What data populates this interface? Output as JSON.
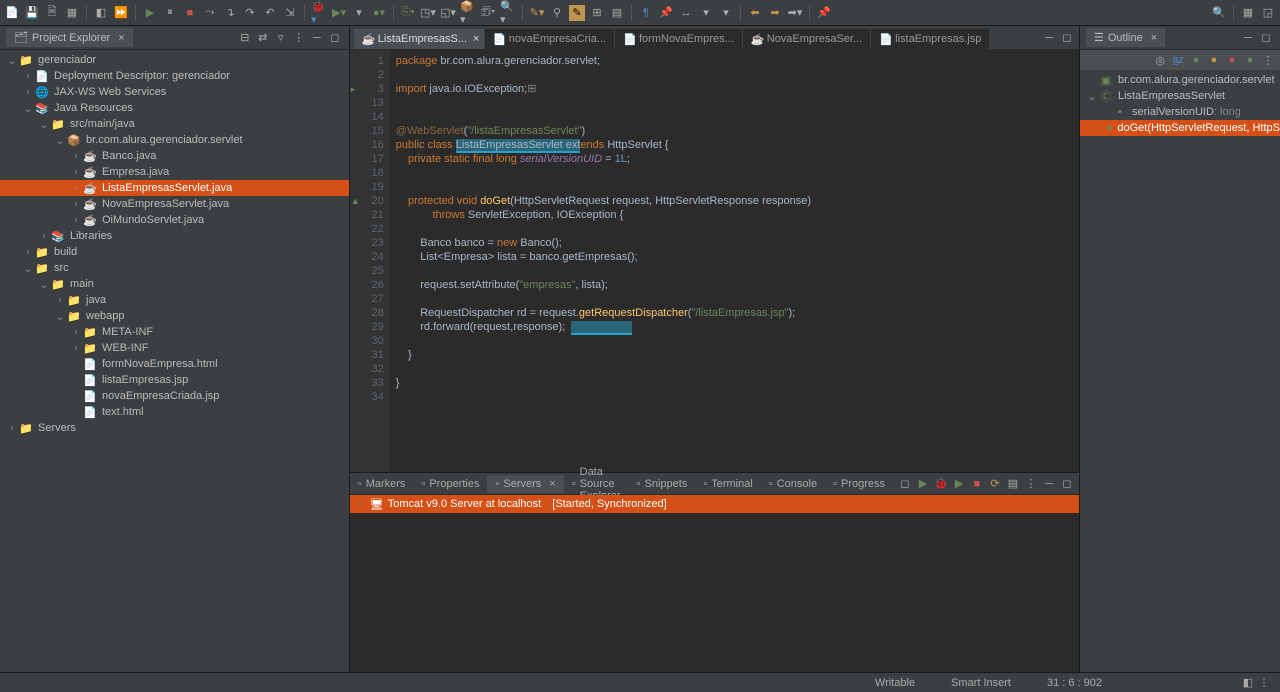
{
  "toolbar": {
    "icons": [
      "new",
      "save",
      "save-all",
      "print",
      "build",
      "sep",
      "run",
      "pause",
      "stop",
      "restart",
      "step-over",
      "step-into",
      "step-out",
      "step-return",
      "resume",
      "sep",
      "debug",
      "coverage",
      "run-last",
      "profile",
      "run-config",
      "sep",
      "new-server",
      "external",
      "ant",
      "search",
      "annotation",
      "task",
      "sep",
      "edit",
      "pencil",
      "highlight",
      "sep",
      "nav-back",
      "nav-fwd",
      "nav-last",
      "sep",
      "pin",
      "link",
      "sync",
      "sep",
      "perspective",
      "sep",
      "back",
      "forward",
      "recent",
      "drop"
    ]
  },
  "projectExplorer": {
    "title": "Project Explorer",
    "tree": [
      {
        "d": 0,
        "exp": true,
        "icon": "project",
        "label": "gerenciador"
      },
      {
        "d": 1,
        "exp": false,
        "icon": "deploy",
        "label": "Deployment Descriptor: gerenciador"
      },
      {
        "d": 1,
        "exp": false,
        "icon": "jax",
        "label": "JAX-WS Web Services"
      },
      {
        "d": 1,
        "exp": true,
        "icon": "javares",
        "label": "Java Resources"
      },
      {
        "d": 2,
        "exp": true,
        "icon": "srcfolder",
        "label": "src/main/java"
      },
      {
        "d": 3,
        "exp": true,
        "icon": "package",
        "label": "br.com.alura.gerenciador.servlet"
      },
      {
        "d": 4,
        "exp": false,
        "icon": "java",
        "label": "Banco.java"
      },
      {
        "d": 4,
        "exp": false,
        "icon": "java",
        "label": "Empresa.java"
      },
      {
        "d": 4,
        "exp": false,
        "icon": "java",
        "label": "ListaEmpresasServlet.java",
        "selected": true
      },
      {
        "d": 4,
        "exp": false,
        "icon": "java",
        "label": "NovaEmpresaServlet.java"
      },
      {
        "d": 4,
        "exp": false,
        "icon": "java",
        "label": "OiMundoServlet.java"
      },
      {
        "d": 2,
        "exp": false,
        "icon": "lib",
        "label": "Libraries"
      },
      {
        "d": 1,
        "exp": false,
        "icon": "folder",
        "label": "build"
      },
      {
        "d": 1,
        "exp": true,
        "icon": "folder",
        "label": "src"
      },
      {
        "d": 2,
        "exp": true,
        "icon": "folder",
        "label": "main"
      },
      {
        "d": 3,
        "exp": false,
        "icon": "folder",
        "label": "java"
      },
      {
        "d": 3,
        "exp": true,
        "icon": "folder",
        "label": "webapp"
      },
      {
        "d": 4,
        "exp": false,
        "icon": "folder",
        "label": "META-INF"
      },
      {
        "d": 4,
        "exp": false,
        "icon": "folder",
        "label": "WEB-INF"
      },
      {
        "d": 4,
        "exp": null,
        "icon": "file",
        "label": "formNovaEmpresa.html"
      },
      {
        "d": 4,
        "exp": null,
        "icon": "jsp",
        "label": "listaEmpresas.jsp"
      },
      {
        "d": 4,
        "exp": null,
        "icon": "jsp",
        "label": "novaEmpresaCriada.jsp"
      },
      {
        "d": 4,
        "exp": null,
        "icon": "file",
        "label": "text.html"
      },
      {
        "d": 0,
        "exp": false,
        "icon": "folder",
        "label": "Servers"
      }
    ]
  },
  "editorTabs": [
    {
      "label": "ListaEmpresasS...",
      "icon": "java",
      "active": true,
      "closeable": true
    },
    {
      "label": "novaEmpresaCria...",
      "icon": "jsp"
    },
    {
      "label": "formNovaEmpres...",
      "icon": "html"
    },
    {
      "label": "NovaEmpresaSer...",
      "icon": "java"
    },
    {
      "label": "listaEmpresas.jsp",
      "icon": "jsp"
    }
  ],
  "code": {
    "lines": [
      {
        "n": 1,
        "html": "<span class='kw'>package</span> br.com.alura.gerenciador.servlet;"
      },
      {
        "n": 2,
        "html": ""
      },
      {
        "n": 3,
        "html": "<span class='kw'>import</span> java.io.IOException;<span class='comment'>⊞</span>",
        "marker": "fold"
      },
      {
        "n": 13,
        "html": ""
      },
      {
        "n": 14,
        "html": ""
      },
      {
        "n": 15,
        "html": "<span class='ann'>@WebServlet</span>(<span class='str'>\"/listaEmpresasServlet\"</span>)"
      },
      {
        "n": 16,
        "html": "<span class='kw'>public class</span> <span class='hl-underline'>ListaEmpresasServlet ext</span><span class='kw'>ends</span> HttpServlet {"
      },
      {
        "n": 17,
        "html": "    <span class='kw'>private static final long</span> <span class='field-italic'>serialVersionUID</span> = <span class='num'>1L</span>;"
      },
      {
        "n": 18,
        "html": ""
      },
      {
        "n": 19,
        "html": ""
      },
      {
        "n": 20,
        "html": "    <span class='kw'>protected void</span> <span class='method'>doGet</span>(HttpServletRequest <span class='type'>request</span>, HttpServletResponse <span class='type'>response</span>)",
        "marker": "override"
      },
      {
        "n": 21,
        "html": "            <span class='kw'>throws</span> ServletException, IOException {"
      },
      {
        "n": 22,
        "html": ""
      },
      {
        "n": 23,
        "html": "        Banco <span class='type'>banco</span> = <span class='kw'>new</span> Banco();"
      },
      {
        "n": 24,
        "html": "        List&lt;<span class='type'>Empresa</span>&gt; <span class='type'>lista</span> = banco.getEmpresas();"
      },
      {
        "n": 25,
        "html": ""
      },
      {
        "n": 26,
        "html": "        request.setAttribute(<span class='str'>\"empresas\"</span>, lista);"
      },
      {
        "n": 27,
        "html": ""
      },
      {
        "n": 28,
        "html": "        RequestDispatcher <span class='type'>rd</span> = request.<span class='method'>getRequestDispatcher</span>(<span class='str'>\"/listaEmpresas.jsp\"</span>);"
      },
      {
        "n": 29,
        "html": "        rd.forward(<span class='type'>request</span>,<span class='type'>response</span>);  <span class='hl-underline'>                    </span>"
      },
      {
        "n": 30,
        "html": ""
      },
      {
        "n": 31,
        "html": "    }"
      },
      {
        "n": 32,
        "html": ""
      },
      {
        "n": 33,
        "html": "}"
      },
      {
        "n": 34,
        "html": ""
      }
    ]
  },
  "outline": {
    "title": "Outline",
    "items": [
      {
        "d": 0,
        "icon": "package",
        "label": "br.com.alura.gerenciador.servlet"
      },
      {
        "d": 0,
        "icon": "class",
        "label": "ListaEmpresasServlet",
        "exp": true
      },
      {
        "d": 1,
        "icon": "field",
        "label": "serialVersionUID",
        "type": ": long"
      },
      {
        "d": 1,
        "icon": "method",
        "label": "doGet(HttpServletRequest, HttpS",
        "selected": true
      }
    ]
  },
  "bottomTabs": [
    {
      "label": "Markers",
      "icon": "markers"
    },
    {
      "label": "Properties",
      "icon": "props"
    },
    {
      "label": "Servers",
      "icon": "servers",
      "active": true,
      "closeable": true
    },
    {
      "label": "Data Source Explorer",
      "icon": "data"
    },
    {
      "label": "Snippets",
      "icon": "snip"
    },
    {
      "label": "Terminal",
      "icon": "term"
    },
    {
      "label": "Console",
      "icon": "console"
    },
    {
      "label": "Progress",
      "icon": "progress"
    }
  ],
  "server": {
    "label": "Tomcat v9.0 Server at localhost",
    "status": "[Started, Synchronized]"
  },
  "statusBar": {
    "writable": "Writable",
    "insert": "Smart Insert",
    "position": "31 : 6 : 902"
  }
}
